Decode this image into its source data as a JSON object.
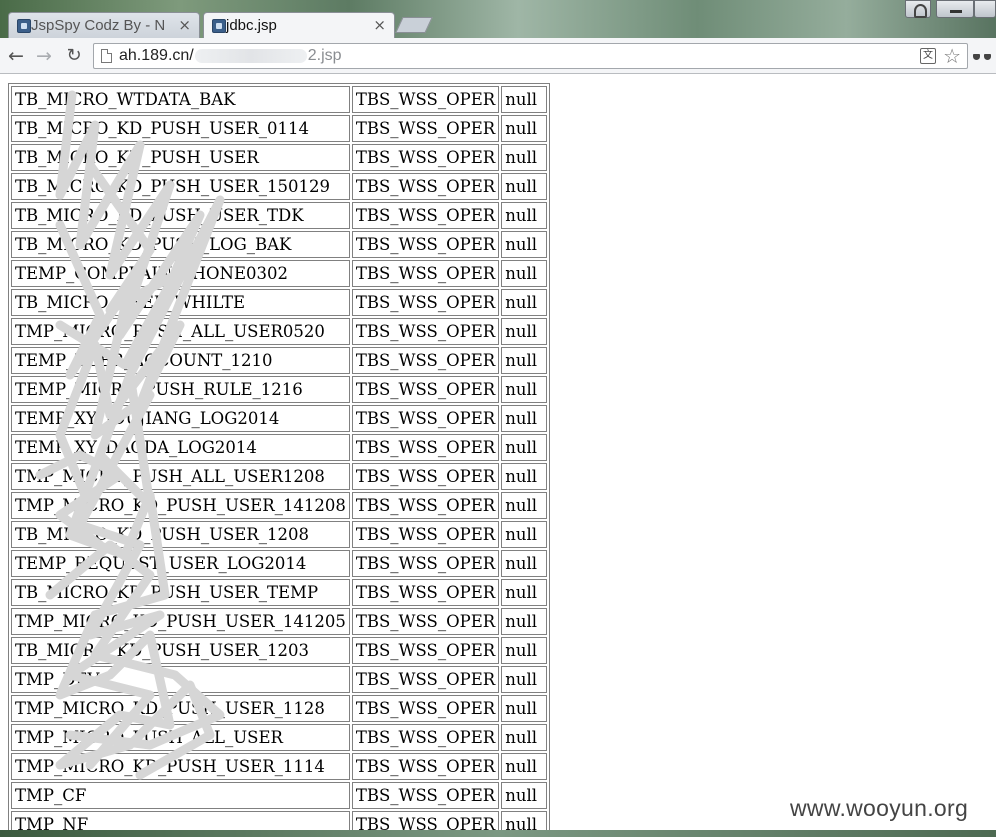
{
  "browser": {
    "tabs": [
      {
        "title": "JspSpy Codz By - N",
        "active": false
      },
      {
        "title": "jdbc.jsp",
        "active": true
      }
    ],
    "close_glyph": "×",
    "address_bar": {
      "url_prefix": "ah.189.cn/",
      "url_suffix": "2.jsp"
    },
    "icons": {
      "back": "←",
      "forward": "→",
      "reload": "↻",
      "star": "☆",
      "translate": "文"
    }
  },
  "table": {
    "rows": [
      [
        "TB_MICRO_WTDATA_BAK",
        "TBS_WSS_OPER",
        "null"
      ],
      [
        "TB_MICRO_KD_PUSH_USER_0114",
        "TBS_WSS_OPER",
        "null"
      ],
      [
        "TB_MICRO_KD_PUSH_USER",
        "TBS_WSS_OPER",
        "null"
      ],
      [
        "TB_MICRO_KD_PUSH_USER_150129",
        "TBS_WSS_OPER",
        "null"
      ],
      [
        "TB_MICRO_KD_PUSH_USER_TDK",
        "TBS_WSS_OPER",
        "null"
      ],
      [
        "TB_MICRO_KD_PUSH_LOG_BAK",
        "TBS_WSS_OPER",
        "null"
      ],
      [
        "TEMP_COMPLAIN_PHONE0302",
        "TBS_WSS_OPER",
        "null"
      ],
      [
        "TB_MICRO_USER_WHILTE",
        "TBS_WSS_OPER",
        "null"
      ],
      [
        "TMP_MICRO_PUSH_ALL_USER0520",
        "TBS_WSS_OPER",
        "null"
      ],
      [
        "TEMP_USER_ACCOUNT_1210",
        "TBS_WSS_OPER",
        "null"
      ],
      [
        "TEMP_MICRO_PUSH_RULE_1216",
        "TBS_WSS_OPER",
        "null"
      ],
      [
        "TEMP_XY_JOUJIANG_LOG2014",
        "TBS_WSS_OPER",
        "null"
      ],
      [
        "TEMP_XY_DAODA_LOG2014",
        "TBS_WSS_OPER",
        "null"
      ],
      [
        "TMP_MICRO_PUSH_ALL_USER1208",
        "TBS_WSS_OPER",
        "null"
      ],
      [
        "TMP_MICRO_KD_PUSH_USER_141208",
        "TBS_WSS_OPER",
        "null"
      ],
      [
        "TB_MICRO_KD_PUSH_USER_1208",
        "TBS_WSS_OPER",
        "null"
      ],
      [
        "TEMP_REQUEST_USER_LOG2014",
        "TBS_WSS_OPER",
        "null"
      ],
      [
        "TB_MICRO_KD_PUSH_USER_TEMP",
        "TBS_WSS_OPER",
        "null"
      ],
      [
        "TMP_MICRO_KD_PUSH_USER_141205",
        "TBS_WSS_OPER",
        "null"
      ],
      [
        "TB_MICRO_KD_PUSH_USER_1203",
        "TBS_WSS_OPER",
        "null"
      ],
      [
        "TMP_DEV",
        "TBS_WSS_OPER",
        "null"
      ],
      [
        "TMP_MICRO_KD_PUSH_USER_1128",
        "TBS_WSS_OPER",
        "null"
      ],
      [
        "TMP_MICRO_PUSH_ALL_USER",
        "TBS_WSS_OPER",
        "null"
      ],
      [
        "TMP_MICRO_KD_PUSH_USER_1114",
        "TBS_WSS_OPER",
        "null"
      ],
      [
        "TMP_CF",
        "TBS_WSS_OPER",
        "null"
      ],
      [
        "TMP_NF",
        "TBS_WSS_OPER",
        "null"
      ]
    ]
  },
  "watermark": "www.wooyun.org",
  "colors": {
    "scribble": "#d6d6d6",
    "border": "#808080"
  }
}
